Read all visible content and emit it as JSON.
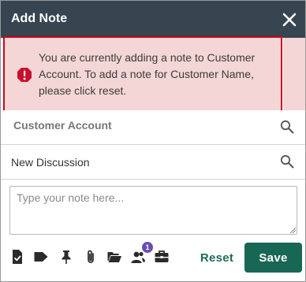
{
  "dialog": {
    "title": "Add Note",
    "close_icon": "close-icon"
  },
  "alert": {
    "icon": "alert-exclamation-icon",
    "message": "You are currently adding a note to Customer Account. To add a note for Customer Name, please click reset.",
    "background_color": "#f5d6d6",
    "border_color": "#d0021b"
  },
  "fields": {
    "account": {
      "value": "Customer Account",
      "icon": "search-icon"
    },
    "discussion": {
      "value": "New Discussion",
      "icon": "search-icon"
    }
  },
  "note": {
    "value": "",
    "placeholder": "Type your note here..."
  },
  "toolbar": {
    "icons": [
      "task-checklist-icon",
      "tag-icon",
      "pin-icon",
      "paperclip-icon",
      "folder-open-icon",
      "people-icon",
      "briefcase-icon"
    ],
    "people_count": "1"
  },
  "actions": {
    "reset_label": "Reset",
    "save_label": "Save"
  },
  "colors": {
    "header": "#36454f",
    "accent": "#186755",
    "badge": "#6a4bb5"
  }
}
